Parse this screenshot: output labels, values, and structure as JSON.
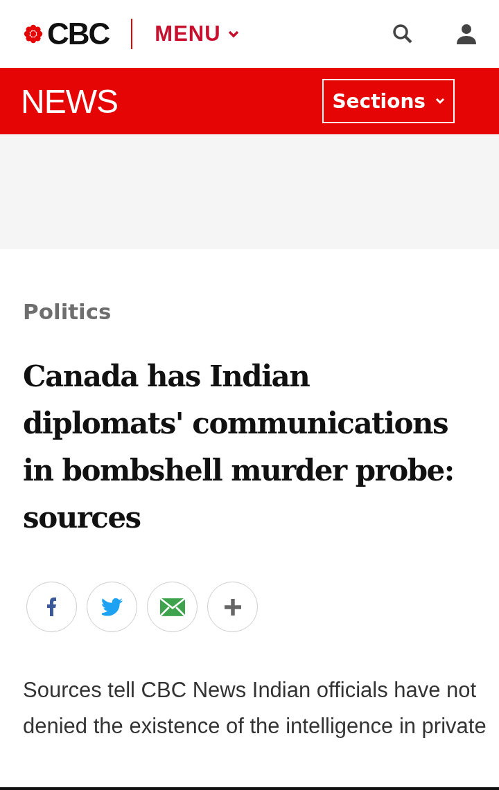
{
  "header": {
    "logo": "CBC",
    "menu": "MENU"
  },
  "news_bar": {
    "title": "NEWS",
    "sections_button": "Sections"
  },
  "article": {
    "category": "Politics",
    "headline": "Canada has Indian diplomats' communications in bombshell murder probe: sources",
    "share_buttons": [
      {
        "kind": "facebook"
      },
      {
        "kind": "twitter"
      },
      {
        "kind": "email"
      },
      {
        "kind": "more"
      }
    ],
    "summary": "Sources tell CBC News Indian officials have not denied the existence of the intelligence in private"
  }
}
